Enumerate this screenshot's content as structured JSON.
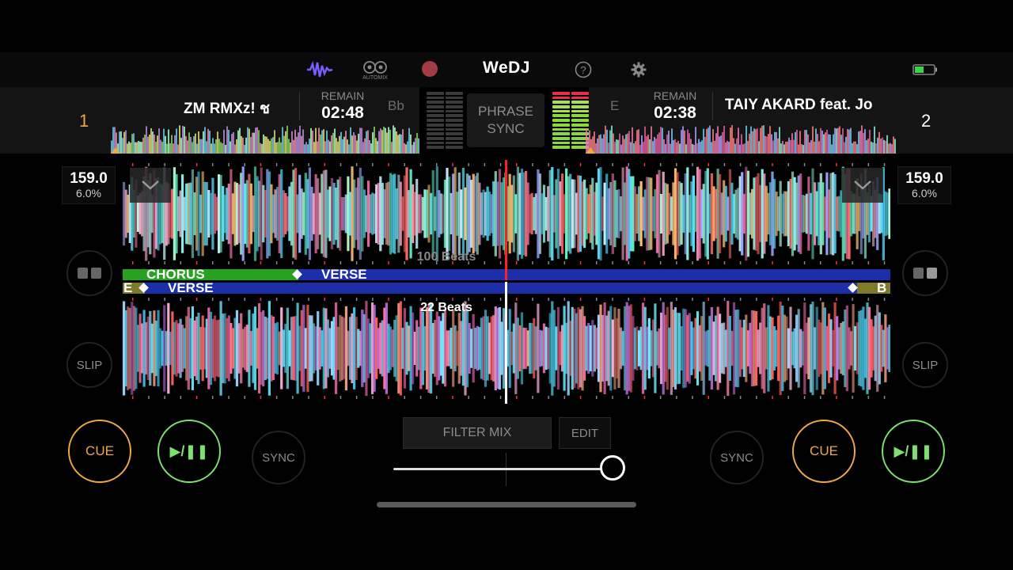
{
  "header": {
    "title": "WeDJ",
    "automix_label": "AUTOMIX",
    "icons": [
      "waveform-icon",
      "automix-icon",
      "record-icon",
      "help-icon",
      "gear-icon",
      "battery-icon"
    ]
  },
  "deck1": {
    "number": "1",
    "title": "ZM RMXz! ช",
    "remain_label": "REMAIN",
    "remain_time": "02:48",
    "key": "Bb",
    "bpm": "159.0",
    "pitch": "6.0%"
  },
  "deck2": {
    "number": "2",
    "title": "TAIY AKARD feat. Jo",
    "remain_label": "REMAIN",
    "remain_time": "02:38",
    "key": "E",
    "bpm": "159.0",
    "pitch": "6.0%"
  },
  "phrase_sync": {
    "line1": "PHRASE",
    "line2": "SYNC"
  },
  "phrases": {
    "deck1_a": "CHORUS",
    "deck1_b": "VERSE",
    "deck2_prev": "E",
    "deck2_a": "VERSE",
    "deck2_next": "B"
  },
  "beats": {
    "top": "100 Beats",
    "bottom": "22 Beats"
  },
  "controls": {
    "cue": "CUE",
    "play": "▶/❚❚",
    "sync": "SYNC",
    "slip": "SLIP",
    "filter_mix": "FILTER MIX",
    "edit": "EDIT",
    "crossfader_position": 0.9
  },
  "colors": {
    "accent_orange": "#f0a848",
    "accent_green": "#7ee06e",
    "playhead": "#ff2020",
    "phrase_blue": "#1d2fa8",
    "chorus_green": "#28a020",
    "waveform_purple": "#7a5cff"
  }
}
